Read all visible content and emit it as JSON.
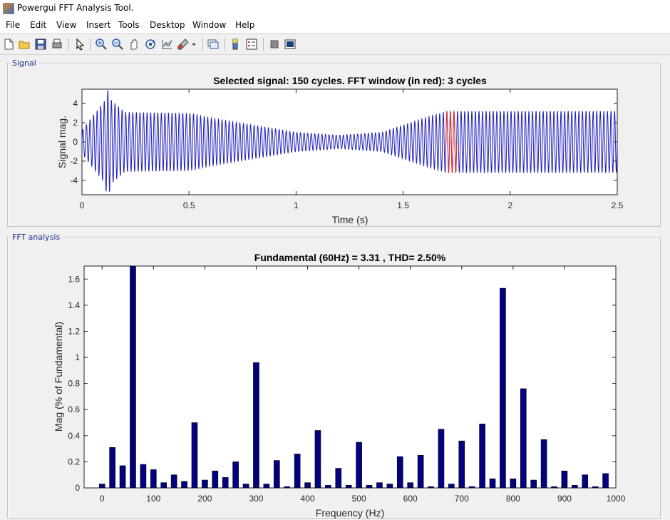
{
  "window": {
    "title": "Powergui FFT Analysis Tool."
  },
  "menu": [
    "File",
    "Edit",
    "View",
    "Insert",
    "Tools",
    "Desktop",
    "Window",
    "Help"
  ],
  "toolbar": {
    "icons": [
      "new-file-icon",
      "open-folder-icon",
      "save-icon",
      "print-icon",
      "pointer-icon",
      "zoom-in-icon",
      "zoom-out-icon",
      "pan-hand-icon",
      "rotate-3d-icon",
      "data-cursor-icon",
      "brush-icon",
      "link-plot-icon",
      "colorbar-icon",
      "legend-icon",
      "hide-plot-tools-icon",
      "show-plot-tools-icon"
    ]
  },
  "signal_panel": {
    "label": "Signal",
    "chart_data": {
      "type": "line",
      "title": "Selected signal: 150 cycles. FFT window (in red): 3 cycles",
      "xlabel": "Time (s)",
      "ylabel": "Signal mag.",
      "xlim": [
        0,
        2.5
      ],
      "ylim": [
        -5.5,
        5.5
      ],
      "xticks": [
        0,
        0.5,
        1,
        1.5,
        2,
        2.5
      ],
      "xtick_labels": [
        "0",
        "0.5",
        "1",
        "1.5",
        "2",
        "2.5"
      ],
      "yticks": [
        4,
        2,
        0,
        -2,
        -4
      ],
      "ytick_labels": [
        "4",
        "2",
        "0",
        "-2",
        "-4"
      ],
      "frequency_hz": 60,
      "cycles": 150,
      "series": [
        {
          "color": "#1f1fbf",
          "x": [
            0,
            0.12,
            0.2,
            0.5,
            0.6,
            1.0,
            1.2,
            1.4,
            1.6,
            1.7,
            2.0,
            2.5
          ],
          "envelope": [
            1.2,
            4.7,
            3.1,
            3.0,
            2.5,
            1.0,
            0.7,
            1.0,
            2.5,
            3.2,
            3.2,
            3.2
          ]
        },
        {
          "color": "#e0302a",
          "x": [
            1.7,
            1.75
          ],
          "envelope": [
            3.2,
            3.2
          ]
        }
      ],
      "fft_window": {
        "start_s": 1.7,
        "cycles": 3,
        "color": "#e0302a"
      }
    }
  },
  "fft_panel": {
    "label": "FFT analysis",
    "chart_data": {
      "type": "bar",
      "title": "Fundamental (60Hz) = 3.31 , THD= 2.50%",
      "xlabel": "Frequency (Hz)",
      "ylabel": "Mag (% of Fundamental)",
      "xlim": [
        -35,
        1000
      ],
      "ylim": [
        0,
        1.7
      ],
      "xticks": [
        0,
        100,
        200,
        300,
        400,
        500,
        600,
        700,
        800,
        900,
        1000
      ],
      "xtick_labels": [
        "0",
        "100",
        "200",
        "300",
        "400",
        "500",
        "600",
        "700",
        "800",
        "900",
        "1000"
      ],
      "yticks": [
        0,
        0.2,
        0.4,
        0.6,
        0.8,
        1,
        1.2,
        1.4,
        1.6
      ],
      "ytick_labels": [
        "0",
        "0.2",
        "0.4",
        "0.6",
        "0.8",
        "1",
        "1.2",
        "1.4",
        "1.6"
      ],
      "bar_color": "#000080",
      "x": [
        0,
        20,
        40,
        60,
        80,
        100,
        120,
        140,
        160,
        180,
        200,
        220,
        240,
        260,
        280,
        300,
        320,
        340,
        360,
        380,
        400,
        420,
        440,
        460,
        480,
        500,
        520,
        540,
        560,
        580,
        600,
        620,
        640,
        660,
        680,
        700,
        720,
        740,
        760,
        780,
        800,
        820,
        840,
        860,
        880,
        900,
        920,
        940,
        960,
        980
      ],
      "values": [
        0.03,
        0.31,
        0.17,
        1.7,
        0.18,
        0.14,
        0.04,
        0.1,
        0.05,
        0.5,
        0.06,
        0.13,
        0.08,
        0.2,
        0.03,
        0.96,
        0.03,
        0.21,
        0.01,
        0.26,
        0.04,
        0.44,
        0.02,
        0.15,
        0.02,
        0.35,
        0.02,
        0.04,
        0.03,
        0.24,
        0.04,
        0.25,
        0.01,
        0.45,
        0.03,
        0.36,
        0.01,
        0.49,
        0.07,
        1.53,
        0.07,
        0.76,
        0.06,
        0.37,
        0.01,
        0.13,
        0.02,
        0.1,
        0.01,
        0.11
      ]
    }
  }
}
